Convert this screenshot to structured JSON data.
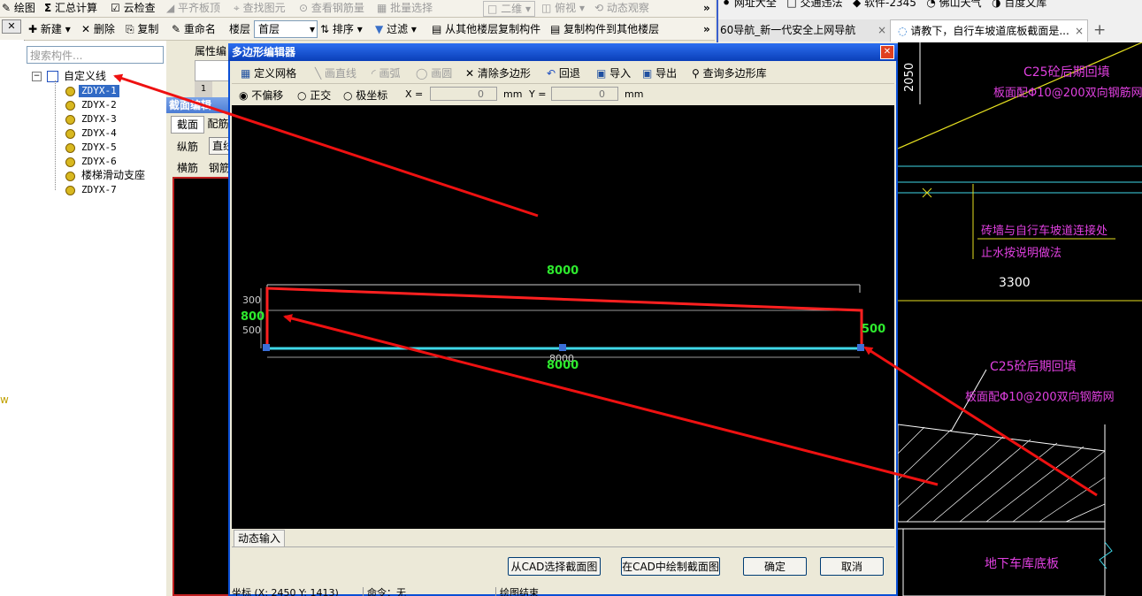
{
  "main_toolbar": {
    "draw": "绘图",
    "sum": "汇总计算",
    "cloud_check": "云检查",
    "flat_slab": "平齐板顶",
    "find_elem": "查找图元",
    "view_rebar": "查看钢筋量",
    "batch_select": "批量选择",
    "view2d": "二维",
    "top_view": "俯视",
    "dyn_observe": "动态观察",
    "more": "»"
  },
  "second_toolbar": {
    "new": "新建",
    "delete": "删除",
    "copy": "复制",
    "rename": "重命名",
    "floor_label": "楼层",
    "floor_value": "首层",
    "sort": "排序",
    "filter": "过滤",
    "copy_from_floor": "从其他楼层复制构件",
    "copy_to_floor": "复制构件到其他楼层",
    "more": "»"
  },
  "left": {
    "close": "✕",
    "sigma": "Σ",
    "edge_char": "w"
  },
  "tree": {
    "search_placeholder": "搜索构件...",
    "root": "自定义线",
    "items": [
      "ZDYX-1",
      "ZDYX-2",
      "ZDYX-3",
      "ZDYX-4",
      "ZDYX-5",
      "ZDYX-6",
      "楼梯滑动支座",
      "ZDYX-7"
    ]
  },
  "bg_panel": {
    "attr_tab": "属性编",
    "row_num": "1",
    "section_title": "截面编辑",
    "tab_section": "截面",
    "tab_rebar": "配筋",
    "longitudinal": "纵筋",
    "straight": "直线",
    "transverse": "横筋",
    "rebar": "钢筋"
  },
  "browser": {
    "fav1": "网址大全",
    "fav2": "交通违法",
    "fav3": "软件-2345",
    "fav4": "佛山天气",
    "fav5": "百度文库",
    "tab1": "60导航_新一代安全上网导航",
    "tab2": "请教下，自行车坡道底板截面是...",
    "new_tab": "+",
    "tab_close": "×"
  },
  "dialog": {
    "title": "多边形编辑器",
    "close": "✕",
    "toolbar": {
      "define_grid": "定义网格",
      "draw_line": "画直线",
      "draw_arc": "画弧",
      "draw_circle": "画圆",
      "clear_polygon": "清除多边形",
      "undo": "回退",
      "import": "导入",
      "export": "导出",
      "query_lib": "查询多边形库"
    },
    "options": {
      "no_offset": "不偏移",
      "orthogonal": "正交",
      "polar": "极坐标",
      "x_label": "X =",
      "x_value": "0",
      "y_label": "Y =",
      "y_value": "0",
      "unit": "mm"
    },
    "drawing": {
      "dim_top": "8000",
      "dim_left": "800",
      "dim_left_small_top": "300",
      "dim_left_small_bottom": "500",
      "dim_right": "500",
      "dim_bottom_small": "8000",
      "dim_bottom": "8000"
    },
    "dyn_input_tab": "动态输入",
    "buttons": {
      "from_cad": "从CAD选择截面图",
      "draw_in_cad": "在CAD中绘制截面图",
      "ok": "确定",
      "cancel": "取消"
    },
    "status": {
      "coord": "坐标 (X: 2450 Y: 1413)",
      "command": "命令：无",
      "draw_end": "绘图结束"
    }
  },
  "cad_right": {
    "dim_vertical": "2050",
    "text1": "C25砼后期回填",
    "text2": "板面配Φ10@200双向钢筋网",
    "text3": "砖墙与自行车坡道连接处",
    "text4": "止水按说明做法",
    "dim_3300": "3300",
    "text5": "C25砼后期回填",
    "text6": "板面配Φ10@200双向钢筋网",
    "text7": "地下车库底板"
  },
  "colors": {
    "cad_green": "#2eea2e",
    "cad_red": "#ff2020",
    "cad_cyan": "#3fd8e8",
    "cad_magenta": "#e040e0",
    "cad_yellow": "#e6e020",
    "arrow_red": "#ee1111"
  }
}
